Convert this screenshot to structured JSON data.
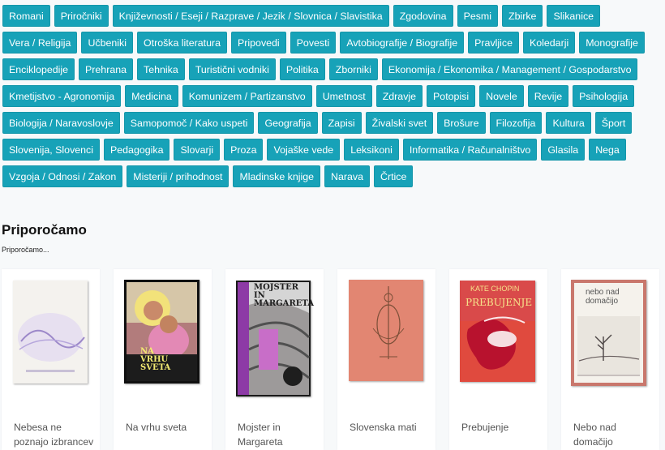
{
  "categories": [
    "Romani",
    "Priročniki",
    "Književnosti / Eseji / Razprave / Jezik / Slovnica / Slavistika",
    "Zgodovina",
    "Pesmi",
    "Zbirke",
    "Slikanice",
    "Vera / Religija",
    "Učbeniki",
    "Otroška literatura",
    "Pripovedi",
    "Povesti",
    "Avtobiografije / Biografije",
    "Pravljice",
    "Koledarji",
    "Monografije",
    "Enciklopedije",
    "Prehrana",
    "Tehnika",
    "Turistični vodniki",
    "Politika",
    "Zborniki",
    "Ekonomija / Ekonomika / Management / Gospodarstvo",
    "Kmetijstvo - Agronomija",
    "Medicina",
    "Komunizem / Partizanstvo",
    "Umetnost",
    "Zdravje",
    "Potopisi",
    "Novele",
    "Revije",
    "Psihologija",
    "Biologija / Naravoslovje",
    "Samopomoč / Kako uspeti",
    "Geografija",
    "Zapisi",
    "Živalski svet",
    "Brošure",
    "Filozofija",
    "Kultura",
    "Šport",
    "Slovenija, Slovenci",
    "Pedagogika",
    "Slovarji",
    "Proza",
    "Vojaške vede",
    "Leksikoni",
    "Informatika / Računalništvo",
    "Glasila",
    "Nega",
    "Vzgoja / Odnosi / Zakon",
    "Misteriji / prihodnost",
    "Mladinske knjige",
    "Narava",
    "Črtice"
  ],
  "recommended": {
    "title": "Priporočamo",
    "subtitle": "Priporočamo..."
  },
  "books": [
    {
      "title": "Nebesa ne poznajo izbrancev",
      "cover_text": "...",
      "cover_text2": ""
    },
    {
      "title": "Na vrhu sveta",
      "cover_text": "NA\nVRHU\nSVETA",
      "cover_text2": ""
    },
    {
      "title": "Mojster in Margareta",
      "cover_text": "MOJSTER\nIN\nMARGARETA",
      "cover_text2": ""
    },
    {
      "title": "Slovenska mati",
      "cover_text": "",
      "cover_text2": ""
    },
    {
      "title": "Prebujenje",
      "cover_text": "KATE CHOPIN",
      "cover_text2": "PREBUJENJE"
    },
    {
      "title": "Nebo nad domačijo",
      "cover_text": "nebo nad\ndomačijo",
      "cover_text2": ""
    }
  ],
  "colors": {
    "tag_bg": "#17a2b8",
    "tag_text": "#ffffff"
  }
}
